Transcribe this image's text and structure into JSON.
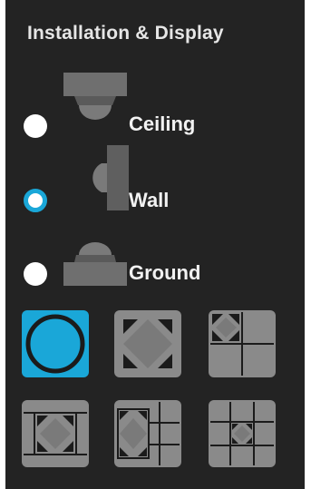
{
  "panel": {
    "title": "Installation & Display"
  },
  "mounting": {
    "options": [
      {
        "label": "Ceiling",
        "icon": "ceiling-mount-camera-icon",
        "selected": false
      },
      {
        "label": "Wall",
        "icon": "wall-mount-camera-icon",
        "selected": true
      },
      {
        "label": "Ground",
        "icon": "ground-mount-camera-icon",
        "selected": false
      }
    ]
  },
  "display_modes": {
    "tiles": [
      {
        "icon": "fisheye-circle-icon",
        "selected": true
      },
      {
        "icon": "panorama-expand-icon",
        "selected": false
      },
      {
        "icon": "quad-view-icon",
        "selected": false
      },
      {
        "icon": "center-split-view-icon",
        "selected": false
      },
      {
        "icon": "side-split-view-icon",
        "selected": false
      },
      {
        "icon": "grid-split-view-icon",
        "selected": false
      }
    ]
  },
  "colors": {
    "panel_bg": "#232323",
    "accent": "#1aa7d8",
    "tile_gray": "#8a8a8a"
  }
}
